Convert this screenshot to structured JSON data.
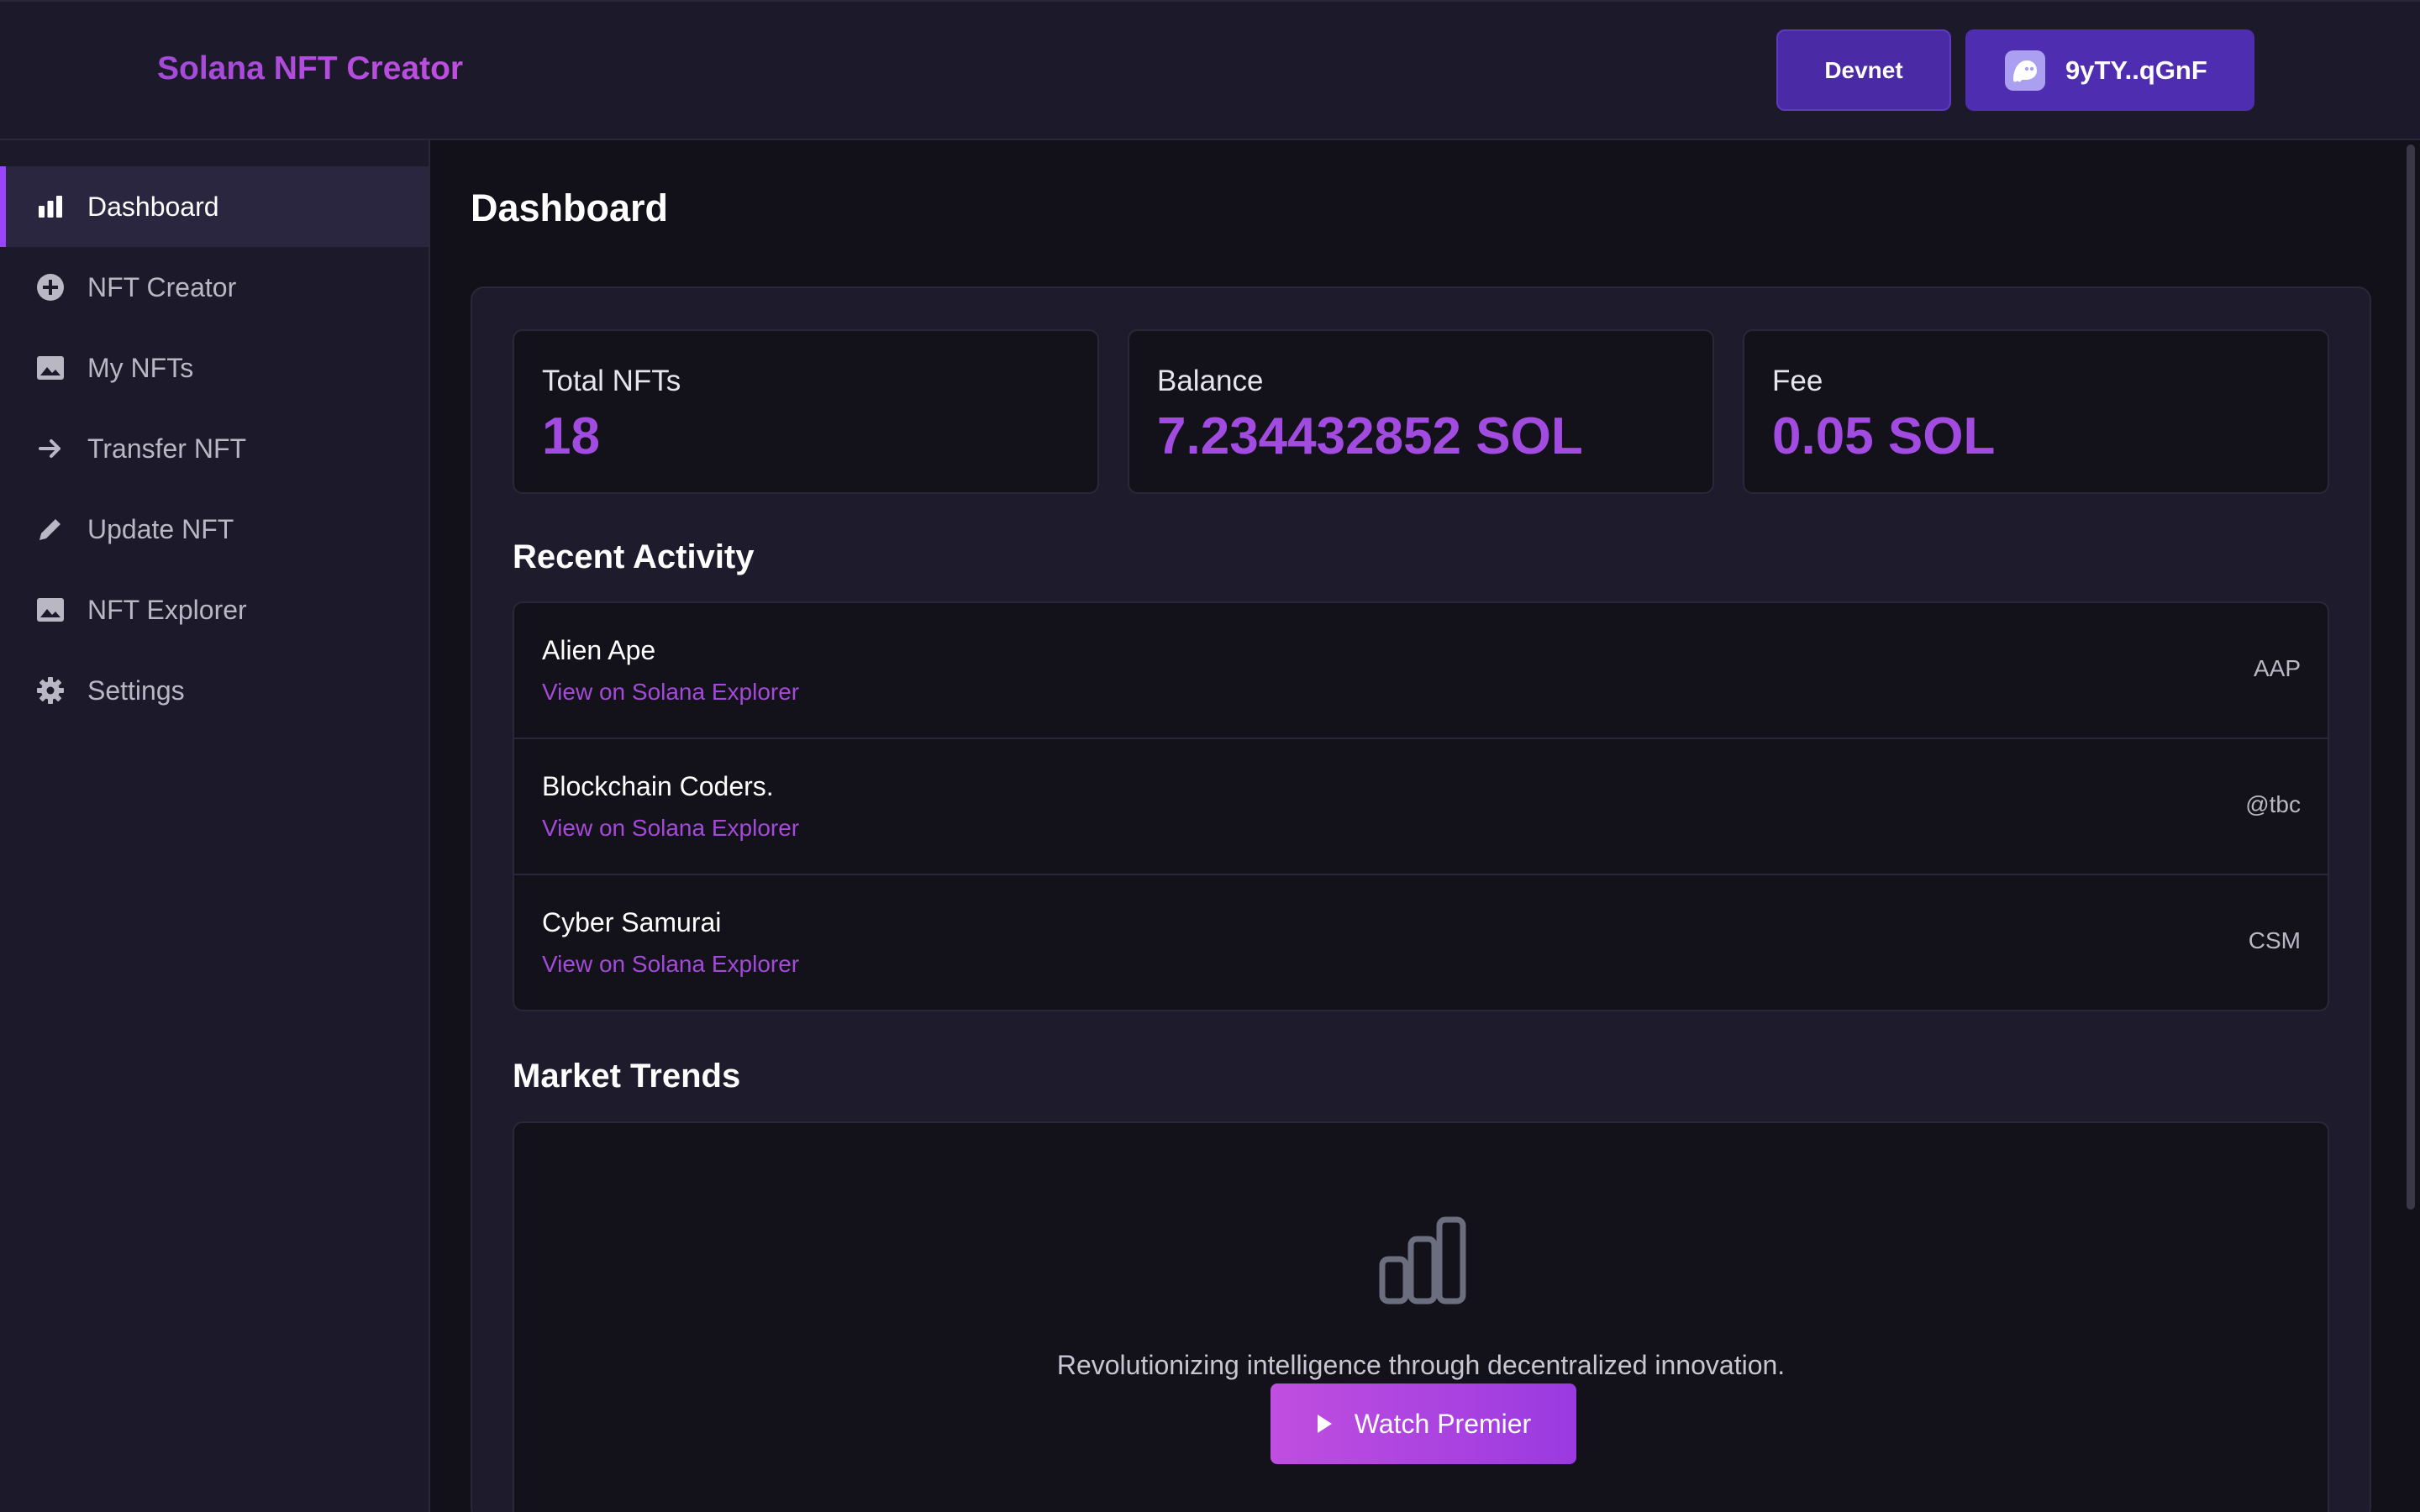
{
  "header": {
    "app_title": "Solana NFT Creator",
    "network_label": "Devnet",
    "wallet_address": "9yTY..qGnF"
  },
  "sidebar": {
    "items": [
      {
        "label": "Dashboard",
        "icon": "bar-chart-icon",
        "active": true
      },
      {
        "label": "NFT Creator",
        "icon": "plus-circle-icon"
      },
      {
        "label": "My NFTs",
        "icon": "image-icon"
      },
      {
        "label": "Transfer NFT",
        "icon": "arrow-right-icon"
      },
      {
        "label": "Update NFT",
        "icon": "pencil-icon"
      },
      {
        "label": "NFT Explorer",
        "icon": "image-icon"
      },
      {
        "label": "Settings",
        "icon": "gear-icon"
      }
    ]
  },
  "main": {
    "title": "Dashboard",
    "stats": [
      {
        "label": "Total NFTs",
        "value": "18"
      },
      {
        "label": "Balance",
        "value": "7.234432852 SOL"
      },
      {
        "label": "Fee",
        "value": "0.05 SOL"
      }
    ],
    "recent_activity": {
      "title": "Recent Activity",
      "items": [
        {
          "name": "Alien Ape",
          "link": "View on Solana Explorer",
          "symbol": "AAP"
        },
        {
          "name": "Blockchain Coders.",
          "link": "View on Solana Explorer",
          "symbol": "@tbc"
        },
        {
          "name": "Cyber Samurai",
          "link": "View on Solana Explorer",
          "symbol": "CSM"
        }
      ]
    },
    "market_trends": {
      "title": "Market Trends",
      "tagline": "Revolutionizing intelligence through decentralized innovation.",
      "button_label": "Watch Premier"
    }
  },
  "colors": {
    "accent": "#9945ff",
    "brand_purple": "#a34ad9",
    "button_purple": "#4f2db0",
    "background": "#121018",
    "panel": "#1c1a2a"
  }
}
